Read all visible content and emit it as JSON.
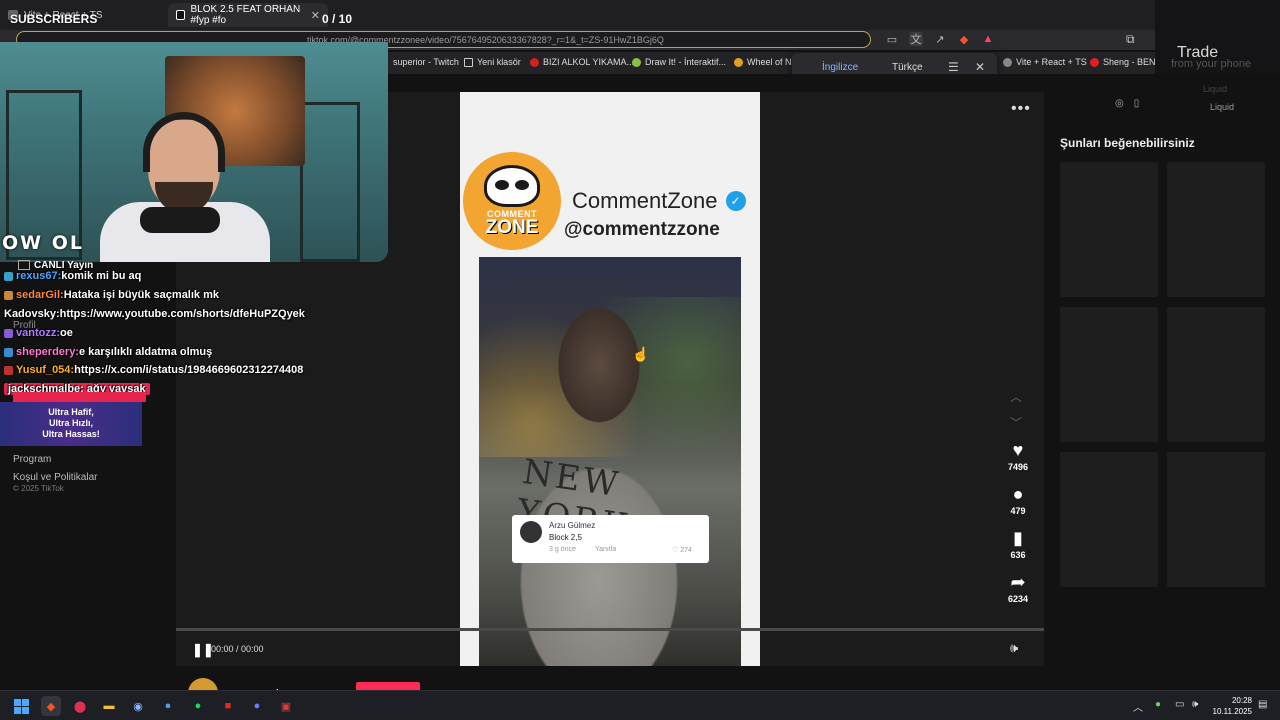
{
  "stream": {
    "subscribers_label": "SUBSCRIBERS",
    "subscribers_count": "0  / 10",
    "logo_text": "OW OL",
    "live_label": "CANLI Yayın",
    "promo_lines": [
      "Ultra Hafif,",
      "Ultra Hızlı,",
      "Ultra Hassas!"
    ]
  },
  "chat": [
    {
      "user": "rexus67:",
      "message": "komik mi bu aq",
      "user_color": "#4aa8ff",
      "badge_color": "#3aa0c8"
    },
    {
      "user": "sedarGil:",
      "message": " Hataka işi büyük saçmalık mk",
      "user_color": "#ff8a3c",
      "badge_color": "#c88a3a"
    },
    {
      "user": "Kadovsky:",
      "message": " https://www.youtube.com/shorts/dfeHuPZQyek",
      "user_color": "#ffffff",
      "badge_color": ""
    },
    {
      "user": "vantozz:",
      "message": " oe",
      "user_color": "#b07cff",
      "badge_color": "#8a5ad0"
    },
    {
      "user": "sheperdery:",
      "message": " e karşılıklı aldatma olmuş",
      "user_color": "#ff7ad0",
      "badge_color": "#3a8ad0"
    },
    {
      "user": "Yusuf_054:",
      "message": " https://x.com/i/status/1984669602312274408",
      "user_color": "#ffb020",
      "badge_color": "#c03030"
    },
    {
      "user": "jackschmalbe:",
      "message": " ağy yavşak",
      "user_color": "#ffffff",
      "badge_color": "",
      "highlight": true
    }
  ],
  "browser": {
    "tabs": [
      {
        "title": "Vite + React + TS"
      },
      {
        "title": "BLOK 2.5 FEAT ORHAN #fyp #fo",
        "active": true
      }
    ],
    "url": "tiktok.com/@commentzzonee/video/7567649520633367828?_r=1&_t=ZS-91HwZ1BGj6Q",
    "bookmarks": [
      "superior - Twitch",
      "Yeni klasör",
      "BIZI ALKOL YIKAMA...",
      "Draw It! - İnteraktif...",
      "Wheel of Na",
      "Vite + React + TS",
      "Sheng - BENZ"
    ],
    "translate": {
      "from": "İngilizce",
      "to": "Türkçe"
    }
  },
  "ad": {
    "title": "Trade",
    "subtitle": "from your phone",
    "liquid_label": "Liquid"
  },
  "sidebar": {
    "profile_label": "Profil",
    "items": [
      "Program",
      "Koşul ve Politikalar"
    ],
    "copyright": "© 2025 TikTok"
  },
  "video": {
    "brand_name": "CommentZone",
    "brand_handle": "@commentzzone",
    "logo_line1": "COMMENT",
    "logo_line2": "ZONE",
    "shirt_text": "NEW YORK",
    "comment": {
      "author": "Arzu Gülmez",
      "text": "Block 2,5",
      "meta": "3 g önce",
      "reply": "Yanıtla",
      "likes": "274"
    },
    "time": "00:00 / 00:00",
    "author": "commentzzonee"
  },
  "actions": {
    "likes": "7496",
    "comments": "479",
    "saves": "636",
    "shares": "6234"
  },
  "suggestions": {
    "title": "Şunları beğenebilirsiniz"
  },
  "taskbar": {
    "time": "20:28",
    "date": "10.11.2025"
  }
}
